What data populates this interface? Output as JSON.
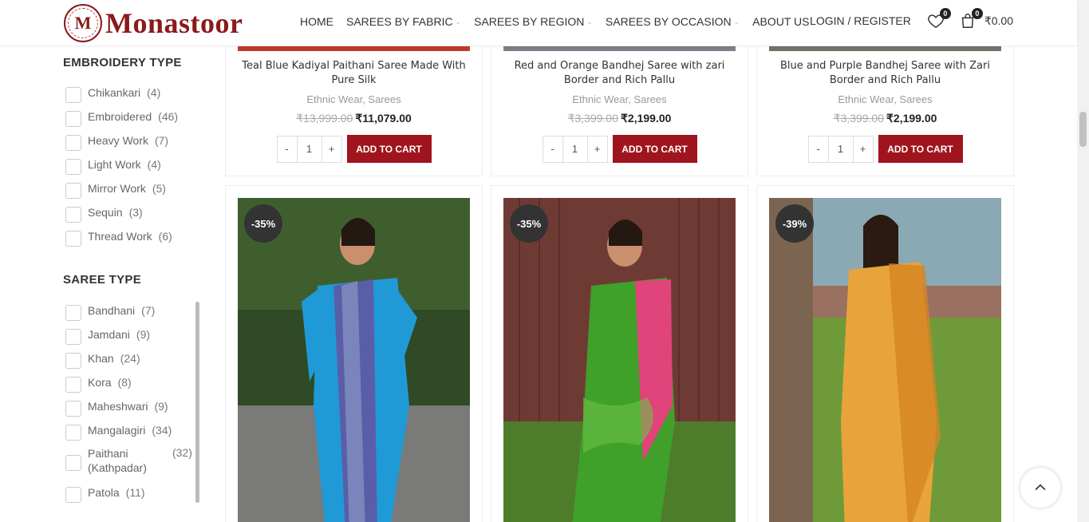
{
  "brand": {
    "logo_letter": "M",
    "name": "Monastoor"
  },
  "nav": {
    "items": [
      {
        "label": "HOME",
        "has_dropdown": false
      },
      {
        "label": "SAREES BY FABRIC",
        "has_dropdown": true
      },
      {
        "label": "SAREES BY REGION",
        "has_dropdown": true
      },
      {
        "label": "SAREES BY OCCASION",
        "has_dropdown": true
      },
      {
        "label": "ABOUT US",
        "has_dropdown": false
      }
    ],
    "chevron": "⌄"
  },
  "header": {
    "login_label": "LOGIN / REGISTER",
    "wishlist_count": "0",
    "cart_count": "0",
    "cart_total": "₹0.00"
  },
  "sidebar": {
    "embroidery": {
      "title": "EMBROIDERY TYPE",
      "items": [
        {
          "label": "Chikankari",
          "count": "(4)"
        },
        {
          "label": "Embroidered",
          "count": "(46)"
        },
        {
          "label": "Heavy Work",
          "count": "(7)"
        },
        {
          "label": "Light Work",
          "count": "(4)"
        },
        {
          "label": "Mirror Work",
          "count": "(5)"
        },
        {
          "label": "Sequin",
          "count": "(3)"
        },
        {
          "label": "Thread Work",
          "count": "(6)"
        }
      ]
    },
    "saree_type": {
      "title": "SAREE TYPE",
      "items": [
        {
          "label": "Bandhani",
          "count": "(7)"
        },
        {
          "label": "Jamdani",
          "count": "(9)"
        },
        {
          "label": "Khan",
          "count": "(24)"
        },
        {
          "label": "Kora",
          "count": "(8)"
        },
        {
          "label": "Maheshwari",
          "count": "(9)"
        },
        {
          "label": "Mangalagiri",
          "count": "(34)"
        },
        {
          "label": "Paithani (Kathpadar)",
          "count": "(32)"
        },
        {
          "label": "Patola",
          "count": "(11)"
        }
      ]
    }
  },
  "products_top": [
    {
      "title": "Teal Blue Kadiyal Paithani Saree Made With Pure Silk",
      "categories": "Ethnic Wear, Sarees",
      "old_price": "₹13,999.00",
      "new_price": "₹11,079.00",
      "qty": "1",
      "button": "ADD TO CART"
    },
    {
      "title": "Red and Orange Bandhej Saree with zari Border and Rich Pallu",
      "categories": "Ethnic Wear, Sarees",
      "old_price": "₹3,399.00",
      "new_price": "₹2,199.00",
      "qty": "1",
      "button": "ADD TO CART"
    },
    {
      "title": "Blue and Purple Bandhej Saree with Zari Border and Rich Pallu",
      "categories": "Ethnic Wear, Sarees",
      "old_price": "₹3,399.00",
      "new_price": "₹2,199.00",
      "qty": "1",
      "button": "ADD TO CART"
    }
  ],
  "products_bottom": [
    {
      "discount": "-35%",
      "palette": {
        "bg": "#2f4a25",
        "saree": "#1f9ad6",
        "accent": "#5a5ea8",
        "ground": "#7a7a78"
      }
    },
    {
      "discount": "-35%",
      "palette": {
        "bg": "#6e3b34",
        "saree": "#3fa02a",
        "accent": "#e0447a",
        "ground": "#4d7c2b"
      }
    },
    {
      "discount": "-39%",
      "palette": {
        "bg": "#7aa0a8",
        "saree": "#e8a43a",
        "accent": "#d48424",
        "ground": "#6f9a3a"
      }
    }
  ],
  "qty_minus": "-",
  "qty_plus": "+",
  "colors": {
    "accent": "#a0151d",
    "brand": "#8b1a1a"
  }
}
